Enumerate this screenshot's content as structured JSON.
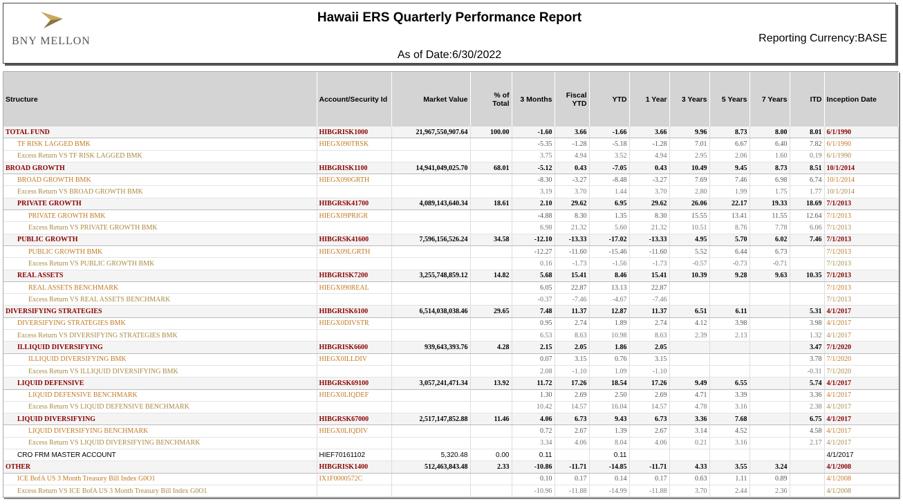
{
  "logo": {
    "text": "BNY MELLON",
    "icon": "bny-mellon-arrow-icon",
    "color": "#b8943c"
  },
  "header": {
    "title": "Hawaii ERS Quarterly Performance Report",
    "currency": "Reporting Currency:BASE",
    "as_of": "As of Date:6/30/2022"
  },
  "columns": [
    "Structure",
    "Account/Security Id",
    "Market Value",
    "% of Total",
    "3 Months",
    "Fiscal YTD",
    "YTD",
    "1 Year",
    "3 Years",
    "5 Years",
    "7 Years",
    "ITD",
    "Inception Date"
  ],
  "rows": [
    {
      "type": "fund",
      "indent": 0,
      "cells": [
        "TOTAL FUND",
        "HIBGRISK1000",
        "21,967,550,907.64",
        "100.00",
        "-1.60",
        "3.66",
        "-1.66",
        "3.66",
        "9.96",
        "8.73",
        "8.00",
        "8.01",
        "6/1/1990"
      ]
    },
    {
      "type": "bmk",
      "indent": 1,
      "cells": [
        "TF RISK LAGGED BMK",
        "HIEGX090TRSK",
        "",
        "",
        "-5.35",
        "-1.28",
        "-5.18",
        "-1.28",
        "7.01",
        "6.67",
        "6.40",
        "7.82",
        "6/1/1990"
      ]
    },
    {
      "type": "excess",
      "indent": 1,
      "cells": [
        "Excess Return VS TF RISK LAGGED BMK",
        "",
        "",
        "",
        "3.75",
        "4.94",
        "3.52",
        "4.94",
        "2.95",
        "2.06",
        "1.60",
        "0.19",
        "6/1/1990"
      ]
    },
    {
      "type": "fund",
      "indent": 0,
      "cells": [
        "BROAD GROWTH",
        "HIBGRISK1100",
        "14,941,049,025.70",
        "68.01",
        "-5.12",
        "0.43",
        "-7.05",
        "0.43",
        "10.49",
        "9.45",
        "8.73",
        "8.51",
        "10/1/2014"
      ]
    },
    {
      "type": "bmk",
      "indent": 1,
      "cells": [
        "BROAD GROWTH BMK",
        "HIEGX090GRTH",
        "",
        "",
        "-8.30",
        "-3.27",
        "-8.48",
        "-3.27",
        "7.69",
        "7.46",
        "6.98",
        "6.74",
        "10/1/2014"
      ]
    },
    {
      "type": "excess",
      "indent": 1,
      "cells": [
        "Excess Return VS BROAD GROWTH BMK",
        "",
        "",
        "",
        "3.19",
        "3.70",
        "1.44",
        "3.70",
        "2.80",
        "1.99",
        "1.75",
        "1.77",
        "10/1/2014"
      ]
    },
    {
      "type": "fund",
      "indent": 1,
      "cells": [
        "PRIVATE GROWTH",
        "HIBGRSK41700",
        "4,089,143,640.34",
        "18.61",
        "2.10",
        "29.62",
        "6.95",
        "29.62",
        "26.06",
        "22.17",
        "19.33",
        "18.69",
        "7/1/2013"
      ]
    },
    {
      "type": "bmk",
      "indent": 2,
      "cells": [
        "PRIVATE GROWTH BMK",
        "HIEGX09PRIGR",
        "",
        "",
        "-4.88",
        "8.30",
        "1.35",
        "8.30",
        "15.55",
        "13.41",
        "11.55",
        "12.64",
        "7/1/2013"
      ]
    },
    {
      "type": "excess",
      "indent": 2,
      "cells": [
        "Excess Return VS PRIVATE GROWTH BMK",
        "",
        "",
        "",
        "6.98",
        "21.32",
        "5.60",
        "21.32",
        "10.51",
        "8.76",
        "7.78",
        "6.06",
        "7/1/2013"
      ]
    },
    {
      "type": "fund",
      "indent": 1,
      "cells": [
        "PUBLIC GROWTH",
        "HIBGRSK41600",
        "7,596,156,526.24",
        "34.58",
        "-12.10",
        "-13.33",
        "-17.02",
        "-13.33",
        "4.95",
        "5.70",
        "6.02",
        "7.46",
        "7/1/2013"
      ]
    },
    {
      "type": "bmk",
      "indent": 2,
      "cells": [
        "PUBLIC GROWTH BMK",
        "HIEGX09LGRTH",
        "",
        "",
        "-12.27",
        "-11.60",
        "-15.46",
        "-11.60",
        "5.52",
        "6.44",
        "6.73",
        "",
        "7/1/2013"
      ]
    },
    {
      "type": "excess",
      "indent": 2,
      "cells": [
        "Excess Return VS PUBLIC GROWTH BMK",
        "",
        "",
        "",
        "0.16",
        "-1.73",
        "-1.56",
        "-1.73",
        "-0.57",
        "-0.73",
        "-0.71",
        "",
        "7/1/2013"
      ]
    },
    {
      "type": "fund",
      "indent": 1,
      "cells": [
        "REAL ASSETS",
        "HIBGRISK7200",
        "3,255,748,859.12",
        "14.82",
        "5.68",
        "15.41",
        "8.46",
        "15.41",
        "10.39",
        "9.28",
        "9.63",
        "10.35",
        "7/1/2013"
      ]
    },
    {
      "type": "bmk",
      "indent": 2,
      "cells": [
        "REAL ASSETS BENCHMARK",
        "HIEGX090REAL",
        "",
        "",
        "6.05",
        "22.87",
        "13.13",
        "22.87",
        "",
        "",
        "",
        "",
        "7/1/2013"
      ]
    },
    {
      "type": "excess",
      "indent": 2,
      "cells": [
        "Excess Return VS REAL ASSETS BENCHMARK",
        "",
        "",
        "",
        "-0.37",
        "-7.46",
        "-4.67",
        "-7.46",
        "",
        "",
        "",
        "",
        "7/1/2013"
      ]
    },
    {
      "type": "fund",
      "indent": 0,
      "cells": [
        "DIVERSIFYING STRATEGIES",
        "HIBGRISK6100",
        "6,514,038,038.46",
        "29.65",
        "7.48",
        "11.37",
        "12.87",
        "11.37",
        "6.51",
        "6.11",
        "",
        "5.31",
        "4/1/2017"
      ]
    },
    {
      "type": "bmk",
      "indent": 1,
      "cells": [
        "DIVERSIFYING STRATEGIES BMK",
        "HIEGX0DIVSTR",
        "",
        "",
        "0.95",
        "2.74",
        "1.89",
        "2.74",
        "4.12",
        "3.98",
        "",
        "3.98",
        "4/1/2017"
      ]
    },
    {
      "type": "excess",
      "indent": 1,
      "cells": [
        "Excess Return VS DIVERSIFYING STRATEGIES BMK",
        "",
        "",
        "",
        "6.53",
        "8.63",
        "10.98",
        "8.63",
        "2.39",
        "2.13",
        "",
        "1.32",
        "4/1/2017"
      ]
    },
    {
      "type": "fund",
      "indent": 1,
      "cells": [
        "ILLIQUID DIVERSIFYING",
        "HIBGRISK6600",
        "939,643,393.76",
        "4.28",
        "2.15",
        "2.05",
        "1.86",
        "2.05",
        "",
        "",
        "",
        "3.47",
        "7/1/2020"
      ]
    },
    {
      "type": "bmk",
      "indent": 2,
      "cells": [
        "ILLIQUID DIVERSIFYING BMK",
        "HIEGX0ILLDIV",
        "",
        "",
        "0.07",
        "3.15",
        "0.76",
        "3.15",
        "",
        "",
        "",
        "3.78",
        "7/1/2020"
      ]
    },
    {
      "type": "excess",
      "indent": 2,
      "cells": [
        "Excess Return VS ILLIQUID DIVERSIFYING BMK",
        "",
        "",
        "",
        "2.08",
        "-1.10",
        "1.09",
        "-1.10",
        "",
        "",
        "",
        "-0.31",
        "7/1/2020"
      ]
    },
    {
      "type": "fund",
      "indent": 1,
      "cells": [
        "LIQUID DEFENSIVE",
        "HIBGRSK69100",
        "3,057,241,471.34",
        "13.92",
        "11.72",
        "17.26",
        "18.54",
        "17.26",
        "9.49",
        "6.55",
        "",
        "5.74",
        "4/1/2017"
      ]
    },
    {
      "type": "bmk",
      "indent": 2,
      "cells": [
        "LIQUID DEFENSIVE BENCHMARK",
        "HIEGX0LIQDEF",
        "",
        "",
        "1.30",
        "2.69",
        "2.50",
        "2.69",
        "4.71",
        "3.39",
        "",
        "3.36",
        "4/1/2017"
      ]
    },
    {
      "type": "excess",
      "indent": 2,
      "cells": [
        "Excess Return VS LIQUID DEFENSIVE BENCHMARK",
        "",
        "",
        "",
        "10.42",
        "14.57",
        "16.04",
        "14.57",
        "4.78",
        "3.16",
        "",
        "2.38",
        "4/1/2017"
      ]
    },
    {
      "type": "fund",
      "indent": 1,
      "cells": [
        "LIQUID DIVERSIFYING",
        "HIBGRSK67000",
        "2,517,147,852.88",
        "11.46",
        "4.06",
        "6.73",
        "9.43",
        "6.73",
        "3.36",
        "7.68",
        "",
        "6.75",
        "4/1/2017"
      ]
    },
    {
      "type": "bmk",
      "indent": 2,
      "cells": [
        "LIQUID DIVERSIFYING BENCHMARK",
        "HIEGX0LIQDIV",
        "",
        "",
        "0.72",
        "2.67",
        "1.39",
        "2.67",
        "3.14",
        "4.52",
        "",
        "4.58",
        "4/1/2017"
      ]
    },
    {
      "type": "excess",
      "indent": 2,
      "cells": [
        "Excess Return VS LIQUID DIVERSIFYING BENCHMARK",
        "",
        "",
        "",
        "3.34",
        "4.06",
        "8.04",
        "4.06",
        "0.21",
        "3.16",
        "",
        "2.17",
        "4/1/2017"
      ]
    },
    {
      "type": "plain",
      "indent": 1,
      "cells": [
        "CRO FRM MASTER ACCOUNT",
        "HIEF70161102",
        "5,320.48",
        "0.00",
        "0.11",
        "",
        "0.11",
        "",
        "",
        "",
        "",
        "",
        "4/1/2017"
      ]
    },
    {
      "type": "fund",
      "indent": 0,
      "cells": [
        "OTHER",
        "HIBGRISK1400",
        "512,463,843.48",
        "2.33",
        "-10.86",
        "-11.71",
        "-14.85",
        "-11.71",
        "4.33",
        "3.55",
        "3.24",
        "",
        "4/1/2008"
      ]
    },
    {
      "type": "bmk",
      "indent": 1,
      "cells": [
        "ICE BofA US 3 Month Treasury Bill Index G0O1",
        "IX1F0000572C",
        "",
        "",
        "0.10",
        "0.17",
        "0.14",
        "0.17",
        "0.63",
        "1.11",
        "0.89",
        "",
        "4/1/2008"
      ]
    },
    {
      "type": "excess",
      "indent": 1,
      "cells": [
        "Excess Return VS ICE BofA US 3 Month Treasury Bill Index G0O1",
        "",
        "",
        "",
        "-10.96",
        "-11.88",
        "-14.99",
        "-11.88",
        "3.70",
        "2.44",
        "2.36",
        "",
        "4/1/2008"
      ]
    }
  ]
}
